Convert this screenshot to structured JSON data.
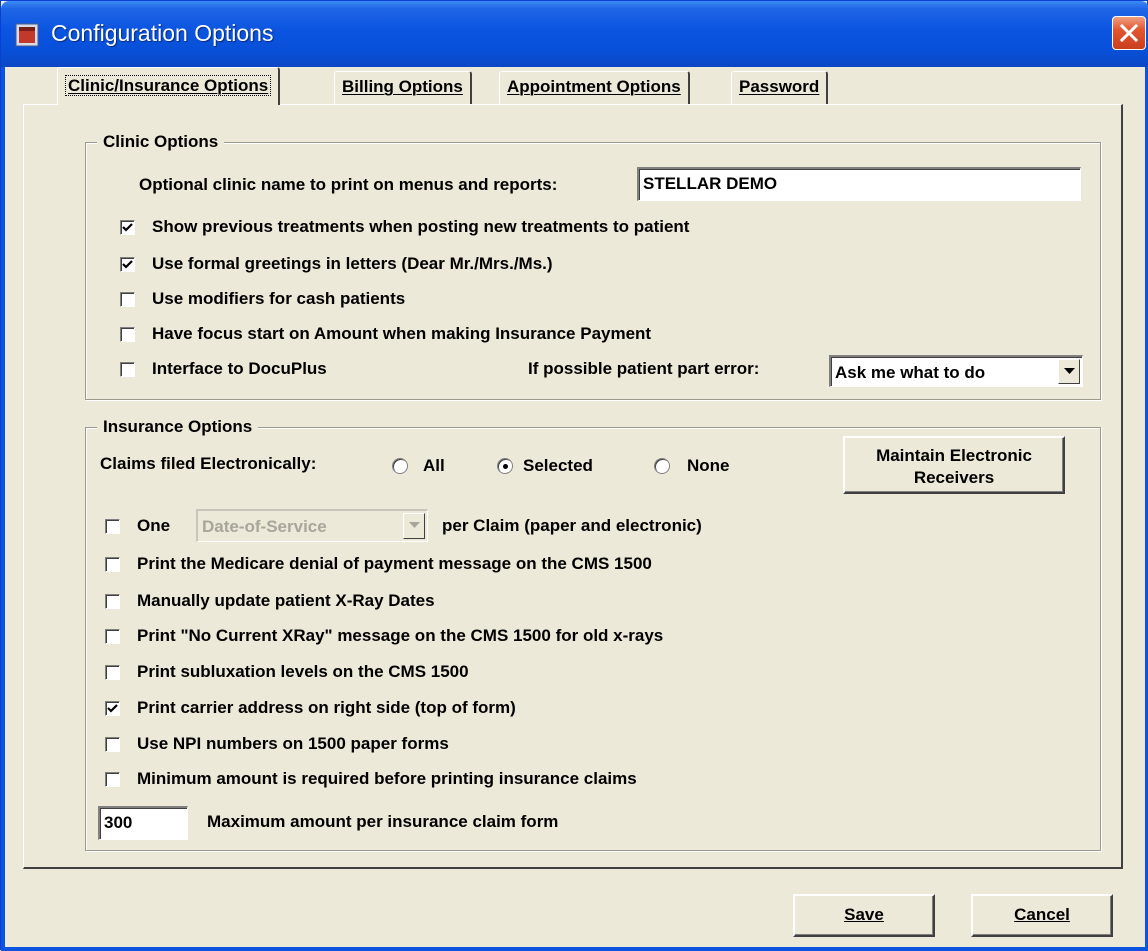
{
  "window": {
    "title": "Configuration Options"
  },
  "tabs": [
    {
      "label": "Clinic/Insurance Options",
      "active": true
    },
    {
      "label": "Billing Options",
      "active": false
    },
    {
      "label": "Appointment Options",
      "active": false
    },
    {
      "label": "Password",
      "active": false
    }
  ],
  "clinic": {
    "group_title": "Clinic Options",
    "name_label": "Optional clinic name to print on menus and reports:",
    "name_value": "STELLAR DEMO",
    "options": [
      {
        "label": "Show previous treatments when posting new treatments to patient",
        "checked": true
      },
      {
        "label": "Use formal greetings in letters (Dear Mr./Mrs./Ms.)",
        "checked": true
      },
      {
        "label": "Use modifiers for cash patients",
        "checked": false
      },
      {
        "label": "Have focus start on Amount when making Insurance Payment",
        "checked": false
      },
      {
        "label": "Interface to DocuPlus",
        "checked": false
      }
    ],
    "part_error_label": "If possible patient part error:",
    "part_error_value": "Ask me what to do"
  },
  "insurance": {
    "group_title": "Insurance Options",
    "claims_label": "Claims filed Electronically:",
    "radios": [
      {
        "label": "All",
        "selected": false
      },
      {
        "label": "Selected",
        "selected": true
      },
      {
        "label": "None",
        "selected": false
      }
    ],
    "maintain_button": "Maintain Electronic Receivers",
    "one_label": "One",
    "one_combo_value": "Date-of-Service",
    "per_claim_label": "per Claim (paper and electronic)",
    "one_checked": false,
    "options": [
      {
        "label": "Print the Medicare denial of payment message on the CMS 1500",
        "checked": false
      },
      {
        "label": "Manually update patient X-Ray Dates",
        "checked": false
      },
      {
        "label": "Print \"No Current XRay\" message on the CMS 1500 for old x-rays",
        "checked": false
      },
      {
        "label": "Print subluxation levels on the CMS 1500",
        "checked": false
      },
      {
        "label": "Print carrier address on right side (top of form)",
        "checked": true
      },
      {
        "label": "Use NPI numbers on 1500 paper forms",
        "checked": false
      },
      {
        "label": "Minimum amount is required before printing insurance claims",
        "checked": false
      }
    ],
    "max_amount_value": "300",
    "max_amount_label": "Maximum amount per insurance claim form"
  },
  "buttons": {
    "save": "Save",
    "cancel": "Cancel"
  },
  "colors": {
    "title_bar": "#0a54e0",
    "face": "#ece9d8",
    "close": "#e2552f"
  },
  "icons": {
    "app": "app-icon",
    "close": "close-icon"
  }
}
